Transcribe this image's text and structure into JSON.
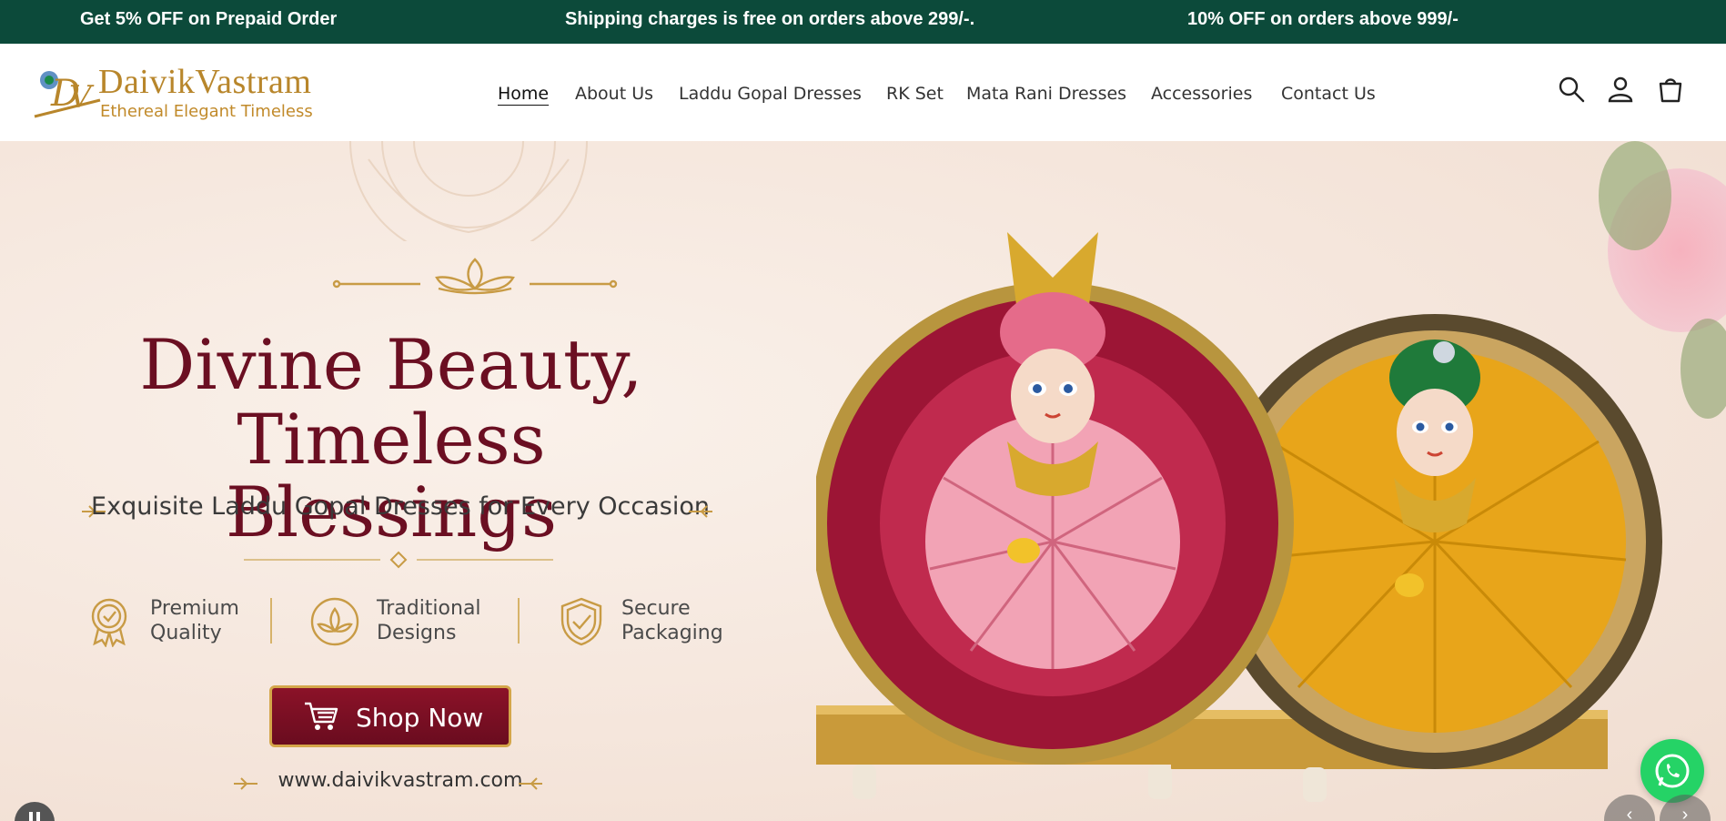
{
  "announcement": {
    "items": [
      "Get 5% OFF on Prepaid Order",
      "Shipping charges is free on orders above 299/-.",
      "10% OFF on orders above 999/-"
    ]
  },
  "header": {
    "logo": {
      "title": "DaivikVastram",
      "tagline": "Ethereal Elegant Timeless",
      "monogram": "DV"
    },
    "nav": [
      "Home",
      "About Us",
      "Laddu Gopal Dresses",
      "RK Set",
      "Mata Rani Dresses",
      "Accessories",
      "Contact Us"
    ],
    "active_nav": "Home",
    "icons": [
      "search-icon",
      "account-icon",
      "cart-icon"
    ]
  },
  "hero": {
    "title_line1": "Divine Beauty,",
    "title_line2": "Timeless Blessings",
    "subtitle": "Exquisite Laddu Gopal Dresses for Every Occasion",
    "features": [
      {
        "line1": "Premium",
        "line2": "Quality",
        "icon": "award-badge-icon"
      },
      {
        "line1": "Traditional",
        "line2": "Designs",
        "icon": "lotus-icon"
      },
      {
        "line1": "Secure",
        "line2": "Packaging",
        "icon": "shield-check-icon"
      }
    ],
    "cta_label": "Shop Now",
    "website": "www.daivikvastram.com"
  },
  "colors": {
    "announcement_bg": "#0c4a3a",
    "accent_gold": "#c18a2a",
    "heading_maroon": "#6b0f22",
    "whatsapp_green": "#25d366"
  }
}
